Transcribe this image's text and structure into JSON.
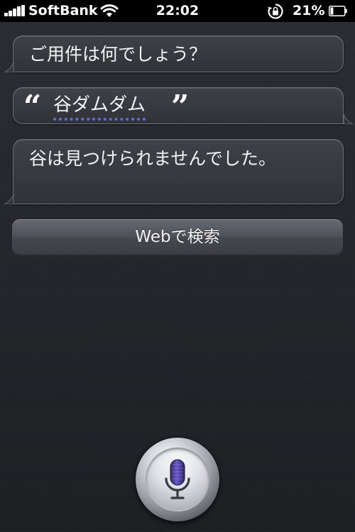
{
  "status_bar": {
    "carrier": "SoftBank",
    "time": "22:02",
    "battery_percent": "21%",
    "signal_bars": 5,
    "battery_level": 0.21,
    "icons": [
      "signal-bars-icon",
      "wifi-icon",
      "rotation-lock-icon",
      "battery-icon"
    ]
  },
  "conversation": {
    "siri_prompt": "ご用件は何でしょう？",
    "user_query": {
      "open_quote": "“",
      "text": "谷ダムダム",
      "close_quote": "”"
    },
    "siri_response": "谷は見つけられませんでした。"
  },
  "web_search_button": {
    "label": "Webで検索"
  },
  "mic": {
    "icon": "microphone-icon",
    "accent_color": "#4b3c9a"
  },
  "colors": {
    "underline_dotted": "#5d6fd8",
    "bubble_border": "#6d7076"
  }
}
